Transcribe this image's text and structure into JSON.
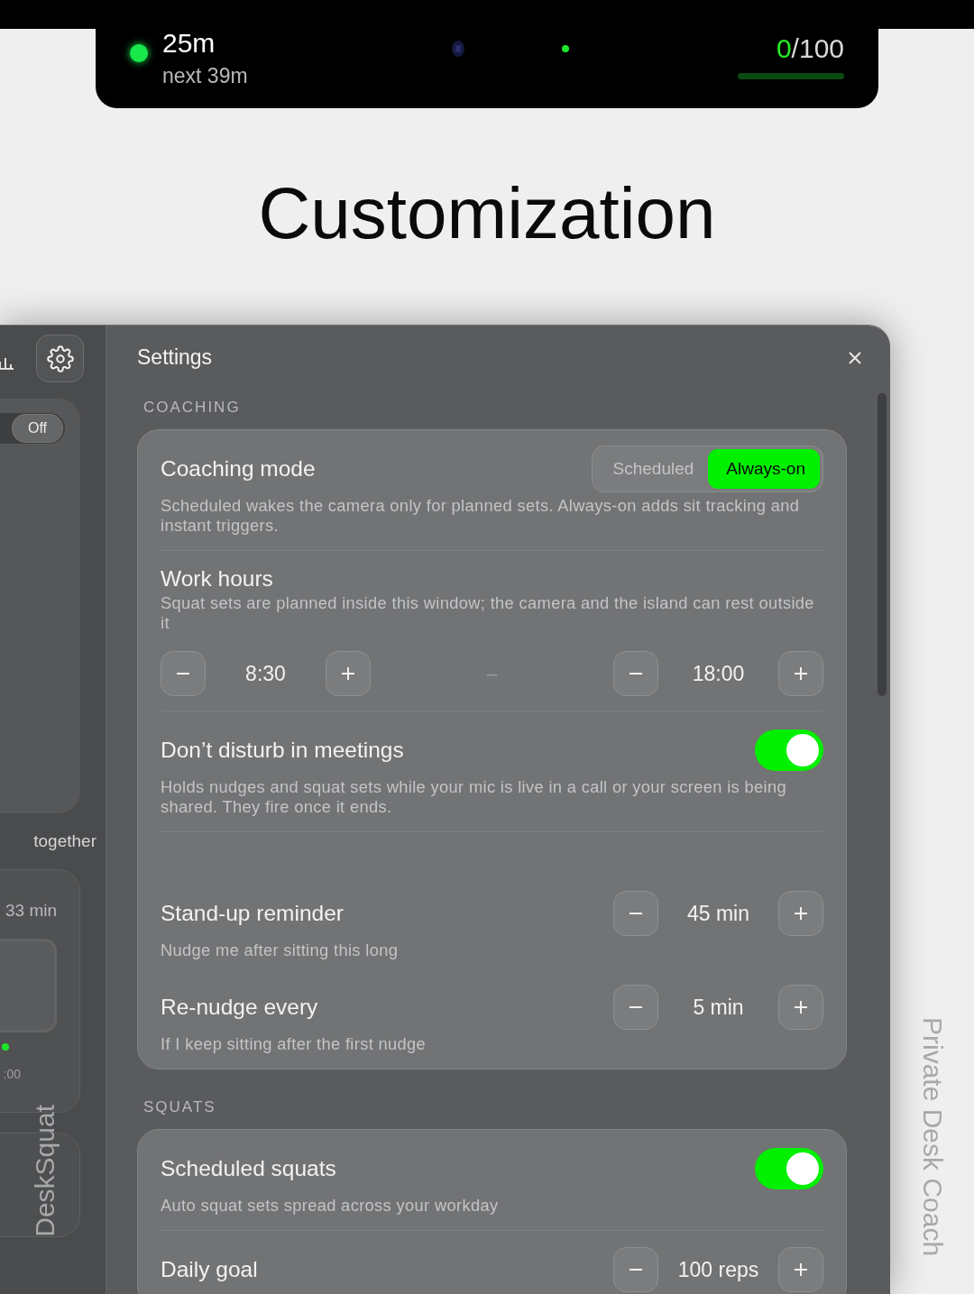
{
  "island": {
    "elapsed": "25m",
    "next": "next 39m",
    "count": "0",
    "goal": "/100",
    "level": 0
  },
  "headline": "Customization",
  "sidebar": {
    "toggle": {
      "label": "Off",
      "on": false
    },
    "together_text": "together",
    "duration": "33 min",
    "time": ":00",
    "brand": "DeskSquat"
  },
  "settings": {
    "title": "Settings",
    "sections": [
      {
        "label": "COACHING",
        "groups": [
          {
            "rows": [
              {
                "kind": "segmented",
                "title": "Coaching mode",
                "options": [
                  {
                    "label": "Scheduled",
                    "selected": false
                  },
                  {
                    "label": "Always-on",
                    "selected": true
                  }
                ],
                "description": "Scheduled wakes the camera only for planned sets. Always-on adds sit tracking and instant triggers."
              }
            ]
          },
          {
            "rows": [
              {
                "kind": "range",
                "title": "Work hours",
                "description": "Squat sets are planned inside this window; the camera and the island can rest outside it",
                "start": "8:30",
                "separator": "–",
                "end": "18:00"
              }
            ]
          },
          {
            "rows": [
              {
                "kind": "toggle",
                "title": "Don’t disturb in meetings",
                "on": true,
                "description": "Holds nudges and squat sets while your mic is live in a call or your screen is being shared. They fire once it ends."
              }
            ]
          },
          {
            "rows": [
              {
                "kind": "stepper",
                "title": "Stand-up reminder",
                "value": "45 min",
                "description": "Nudge me after sitting this long"
              },
              {
                "kind": "stepper",
                "title": "Re-nudge every",
                "value": "5 min",
                "description": "If I keep sitting after the first nudge"
              }
            ]
          }
        ]
      },
      {
        "label": "SQUATS",
        "groups": [
          {
            "rows": [
              {
                "kind": "toggle",
                "title": "Scheduled squats",
                "on": true,
                "description": "Auto squat sets spread across your workday"
              }
            ]
          },
          {
            "rows": [
              {
                "kind": "stepper",
                "title": "Daily goal",
                "value": "100 reps"
              }
            ]
          }
        ]
      }
    ]
  },
  "side_caption": "Private Desk Coach"
}
